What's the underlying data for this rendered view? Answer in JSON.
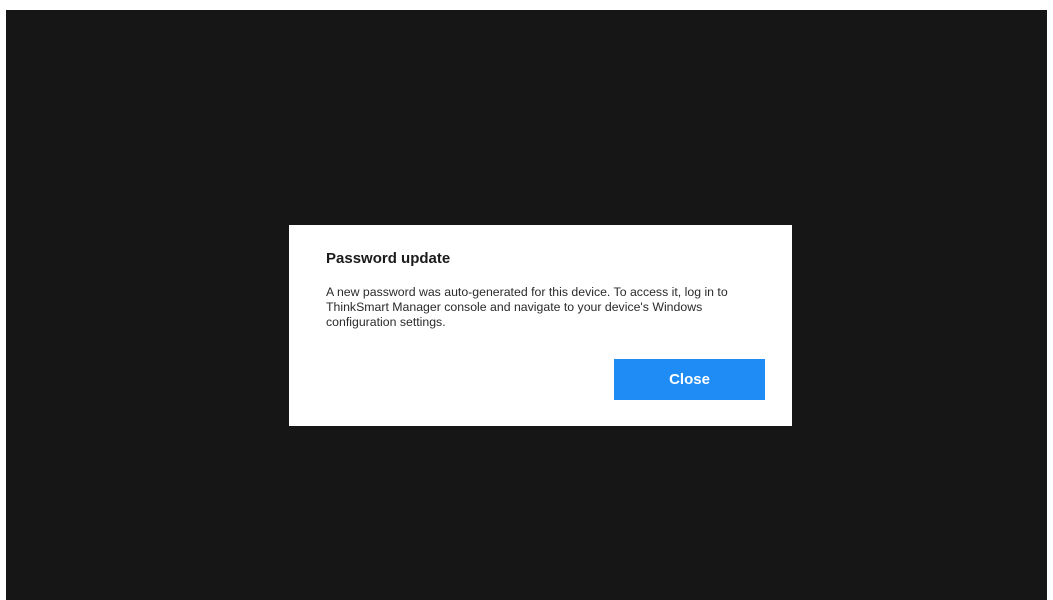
{
  "dialog": {
    "title": "Password update",
    "body": "A new password was auto-generated for this device. To access it, log in to ThinkSmart Manager console and navigate to your device's Windows configuration settings.",
    "close_label": "Close"
  },
  "colors": {
    "background": "#161616",
    "dialog_background": "#ffffff",
    "accent": "#1f8cf5"
  }
}
